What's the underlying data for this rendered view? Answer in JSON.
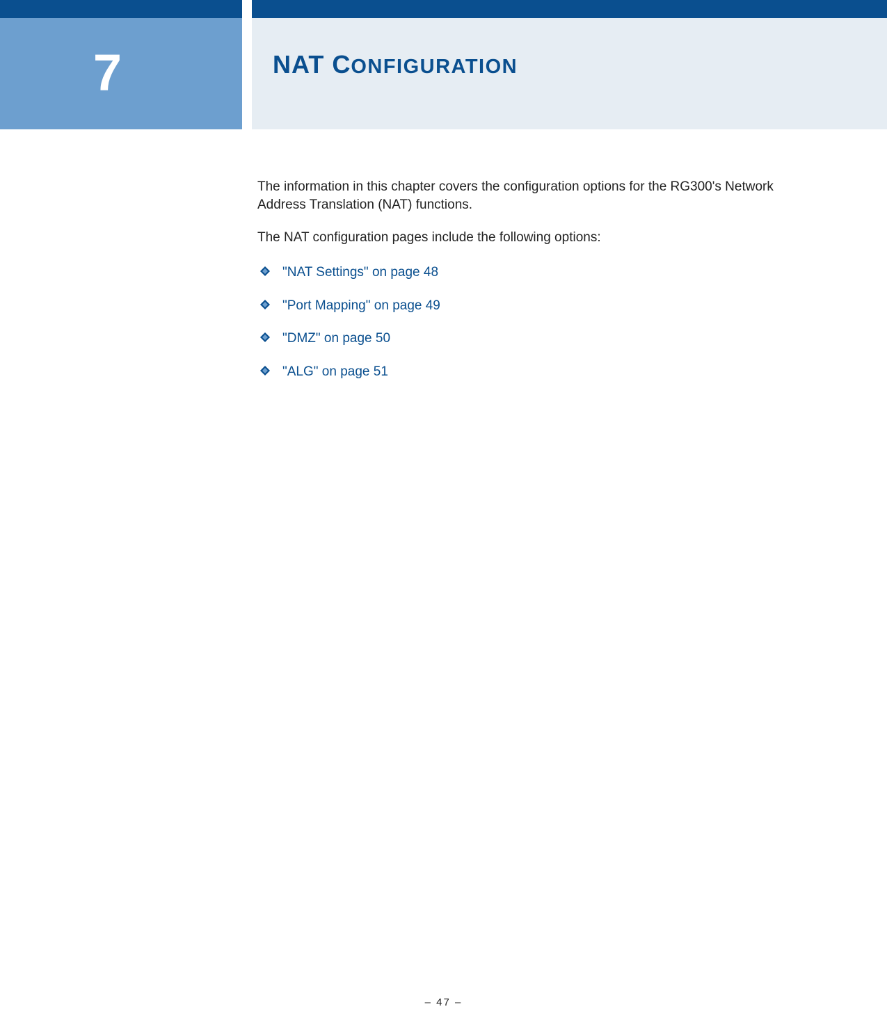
{
  "chapter": {
    "number": "7",
    "title_lead": "NAT C",
    "title_rest": "ONFIGURATION"
  },
  "body": {
    "intro1": "The information in this chapter covers the configuration options for the RG300's Network Address Translation (NAT) functions.",
    "intro2": "The NAT configuration pages include the following options:",
    "links": [
      {
        "text": "\"NAT Settings\" on page 48"
      },
      {
        "text": "\"Port Mapping\" on page 49"
      },
      {
        "text": "\"DMZ\" on page 50"
      },
      {
        "text": "\"ALG\" on page 51"
      }
    ]
  },
  "footer": {
    "page_label": "–  47  –"
  },
  "colors": {
    "brand_dark": "#0a4f8f",
    "brand_light": "#6d9fcf",
    "band_bg": "#e6edf3"
  }
}
